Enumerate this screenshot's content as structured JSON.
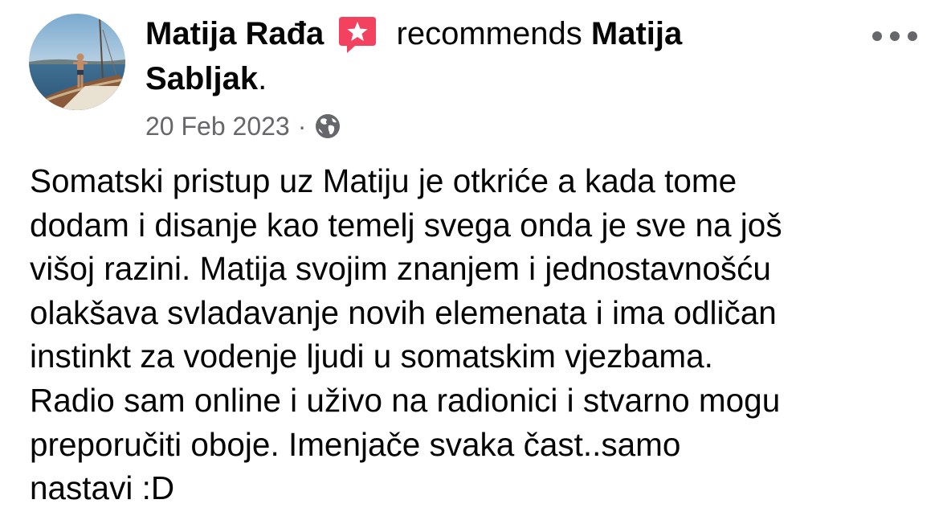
{
  "post": {
    "author": "Matija Rađa",
    "action": "recommends",
    "recommended_page": "Matija Sabljak",
    "date": "20 Feb 2023",
    "separator": "·",
    "privacy_icon": "globe-icon",
    "recommendation_badge_icon": "star-speech-bubble-icon",
    "menu_icon": "more-options-icon",
    "body": "Somatski pristup uz Matiju je otkriće a kada tome\ndodam i disanje kao temelj svega onda je sve na još\nvišoj razini. Matija svojim znanjem i jednostavnošću\nolakšava svladavanje novih elemenata i ima odličan\ninstinkt za vodenje ljudi u somatskim vjezbama.\nRadio sam online i uživo na radionici i stvarno mogu\npreporučiti oboje. Imenjače svaka čast..samo\nnastavi :D"
  },
  "colors": {
    "text": "#050505",
    "secondary_text": "#65676b",
    "badge": "#f3425f"
  }
}
